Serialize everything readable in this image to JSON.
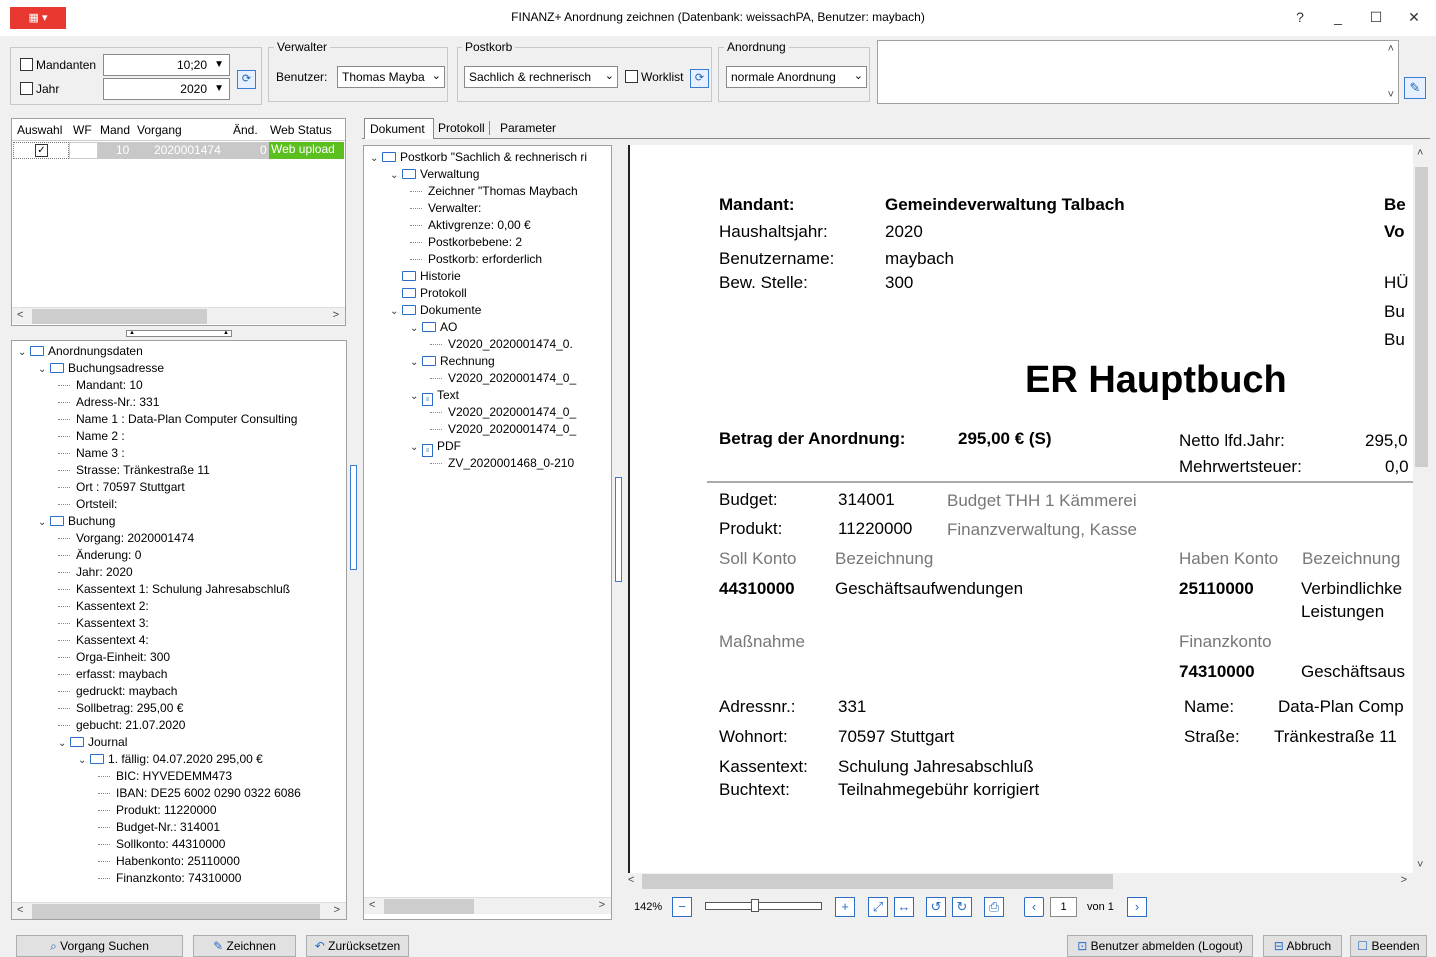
{
  "window": {
    "app_menu": "▦ ▾",
    "title": "FINANZ+ Anordnung zeichnen (Datenbank: weissachPA, Benutzer: maybach)",
    "help": "?",
    "minimize": "_",
    "maximize": "☐",
    "close": "✕"
  },
  "filters": {
    "mandanten_label": "Mandanten",
    "mandanten_value": "10;20",
    "jahr_label": "Jahr",
    "jahr_value": "2020",
    "verwalter_group": "Verwalter",
    "benutzer_label": "Benutzer:",
    "benutzer_value": "Thomas Mayba",
    "postkorb_group": "Postkorb",
    "postkorb_value": "Sachlich & rechnerisch",
    "worklist_label": "Worklist",
    "anordnung_group": "Anordnung",
    "anordnung_value": "normale Anordnung"
  },
  "grid": {
    "columns": [
      "Auswahl",
      "WF",
      "Mand",
      "Vorgang",
      "Änd.",
      "Web Status"
    ],
    "row": {
      "mand": "10",
      "vorgang": "2020001474",
      "aend": "0",
      "status": "Web upload"
    }
  },
  "left_tree": [
    {
      "label": "Anordnungsdaten",
      "level": 0,
      "type": "folder",
      "toggle": "v"
    },
    {
      "label": "Buchungsadresse",
      "level": 1,
      "type": "folder",
      "toggle": "v"
    },
    {
      "label": "Mandant: 10",
      "level": 2,
      "type": "leaf"
    },
    {
      "label": "Adress-Nr.: 331",
      "level": 2,
      "type": "leaf"
    },
    {
      "label": "Name 1 : Data-Plan Computer Consulting",
      "level": 2,
      "type": "leaf"
    },
    {
      "label": "Name 2 :",
      "level": 2,
      "type": "leaf"
    },
    {
      "label": "Name 3 :",
      "level": 2,
      "type": "leaf"
    },
    {
      "label": "Strasse: Tränkestraße 11",
      "level": 2,
      "type": "leaf"
    },
    {
      "label": "Ort    : 70597 Stuttgart",
      "level": 2,
      "type": "leaf"
    },
    {
      "label": "Ortsteil:",
      "level": 2,
      "type": "leaf"
    },
    {
      "label": "Buchung",
      "level": 1,
      "type": "folder",
      "toggle": "v"
    },
    {
      "label": "Vorgang: 2020001474",
      "level": 2,
      "type": "leaf"
    },
    {
      "label": "Änderung: 0",
      "level": 2,
      "type": "leaf"
    },
    {
      "label": "Jahr: 2020",
      "level": 2,
      "type": "leaf"
    },
    {
      "label": "Kassentext 1: Schulung Jahresabschluß",
      "level": 2,
      "type": "leaf"
    },
    {
      "label": "Kassentext 2:",
      "level": 2,
      "type": "leaf"
    },
    {
      "label": "Kassentext 3:",
      "level": 2,
      "type": "leaf"
    },
    {
      "label": "Kassentext 4:",
      "level": 2,
      "type": "leaf"
    },
    {
      "label": "Orga-Einheit: 300",
      "level": 2,
      "type": "leaf"
    },
    {
      "label": "erfasst: maybach",
      "level": 2,
      "type": "leaf"
    },
    {
      "label": "gedruckt: maybach",
      "level": 2,
      "type": "leaf"
    },
    {
      "label": "Sollbetrag: 295,00 €",
      "level": 2,
      "type": "leaf"
    },
    {
      "label": "gebucht: 21.07.2020",
      "level": 2,
      "type": "leaf"
    },
    {
      "label": "Journal",
      "level": 2,
      "type": "folder",
      "toggle": "v"
    },
    {
      "label": "1.   fällig: 04.07.2020  295,00 €",
      "level": 3,
      "type": "folder",
      "toggle": "v"
    },
    {
      "label": "BIC: HYVEDEMM473",
      "level": 4,
      "type": "leaf"
    },
    {
      "label": "IBAN: DE25 6002 0290 0322 6086",
      "level": 4,
      "type": "leaf"
    },
    {
      "label": "Produkt: 11220000",
      "level": 4,
      "type": "leaf"
    },
    {
      "label": "Budget-Nr.: 314001",
      "level": 4,
      "type": "leaf"
    },
    {
      "label": "Sollkonto: 44310000",
      "level": 4,
      "type": "leaf"
    },
    {
      "label": "Habenkonto: 25110000",
      "level": 4,
      "type": "leaf"
    },
    {
      "label": "Finanzkonto: 74310000",
      "level": 4,
      "type": "leaf"
    }
  ],
  "tabs": [
    "Dokument",
    "Protokoll",
    "Parameter"
  ],
  "doc_tree": [
    {
      "label": "Postkorb \"Sachlich & rechnerisch ri",
      "level": 0,
      "type": "folder",
      "toggle": "v"
    },
    {
      "label": "Verwaltung",
      "level": 1,
      "type": "folder",
      "toggle": "v"
    },
    {
      "label": "Zeichner \"Thomas Maybach",
      "level": 2,
      "type": "leaf"
    },
    {
      "label": "Verwalter:",
      "level": 2,
      "type": "leaf"
    },
    {
      "label": "Aktivgrenze: 0,00 €",
      "level": 2,
      "type": "leaf"
    },
    {
      "label": "Postkorbebene: 2",
      "level": 2,
      "type": "leaf"
    },
    {
      "label": "Postkorb: erforderlich",
      "level": 2,
      "type": "leaf"
    },
    {
      "label": "Historie",
      "level": 1,
      "type": "folder"
    },
    {
      "label": "Protokoll",
      "level": 1,
      "type": "folder"
    },
    {
      "label": "Dokumente",
      "level": 1,
      "type": "folder",
      "toggle": "v"
    },
    {
      "label": "AO",
      "level": 2,
      "type": "folder",
      "toggle": "v"
    },
    {
      "label": "V2020_2020001474_0.",
      "level": 3,
      "type": "leaf"
    },
    {
      "label": "Rechnung",
      "level": 2,
      "type": "folder",
      "toggle": "v"
    },
    {
      "label": "V2020_2020001474_0_",
      "level": 3,
      "type": "leaf"
    },
    {
      "label": "Text",
      "level": 2,
      "type": "doc",
      "toggle": "v"
    },
    {
      "label": "V2020_2020001474_0_",
      "level": 3,
      "type": "leaf"
    },
    {
      "label": "V2020_2020001474_0_",
      "level": 3,
      "type": "leaf"
    },
    {
      "label": "PDF",
      "level": 2,
      "type": "doc",
      "toggle": "v"
    },
    {
      "label": "ZV_2020001468_0-210",
      "level": 3,
      "type": "leaf"
    }
  ],
  "document": {
    "mandant_label": "Mandant:",
    "mandant_value": "Gemeindeverwaltung Talbach",
    "haushalt_label": "Haushaltsjahr:",
    "haushalt_value": "2020",
    "benutzer_label": "Benutzername:",
    "benutzer_value": "maybach",
    "stelle_label": "Bew. Stelle:",
    "stelle_value": "300",
    "right_col": [
      "Be",
      "Vo",
      "HÜ",
      "Bu",
      "Bu"
    ],
    "heading": "ER Hauptbuch",
    "betrag_label": "Betrag der Anordnung:",
    "betrag_value": "295,00 € (S)",
    "netto_label": "Netto lfd.Jahr:",
    "netto_value": "295,0",
    "mwst_label": "Mehrwertsteuer:",
    "mwst_value": "0,0",
    "budget_label": "Budget:",
    "budget_value": "314001",
    "budget_desc": "Budget THH 1 Kämmerei",
    "produkt_label": "Produkt:",
    "produkt_value": "11220000",
    "produkt_desc": "Finanzverwaltung, Kasse",
    "soll_konto_h": "Soll Konto",
    "bezeichnung_h": "Bezeichnung",
    "haben_konto_h": "Haben Konto",
    "bezeichnung_h2": "Bezeichnung",
    "soll_konto": "44310000",
    "soll_desc": "Geschäftsaufwendungen",
    "haben_konto": "25110000",
    "haben_desc1": "Verbindlichke",
    "haben_desc2": "Leistungen",
    "massnahme_h": "Maßnahme",
    "finanzkonto_h": "Finanzkonto",
    "finanzkonto": "74310000",
    "finanz_desc": "Geschäftsaus",
    "adressnr_label": "Adressnr.:",
    "adressnr_value": "331",
    "name_label": "Name:",
    "name_value": "Data-Plan Comp",
    "wohnort_label": "Wohnort:",
    "wohnort_value": "70597 Stuttgart",
    "strasse_label": "Straße:",
    "strasse_value": "Tränkestraße 11",
    "kassentext_label": "Kassentext:",
    "kassentext_value": "Schulung Jahresabschluß",
    "buchtext_label": "Buchtext:",
    "buchtext_value": "Teilnahmegebühr korrigiert"
  },
  "viewer": {
    "zoom": "142%",
    "page": "1",
    "of": "von 1"
  },
  "buttons": {
    "vorgang_suchen": "Vorgang Suchen",
    "zeichnen": "Zeichnen",
    "zuruecksetzen": "Zurücksetzen",
    "logout": "Benutzer abmelden (Logout)",
    "abbruch": "Abbruch",
    "beenden": "Beenden"
  }
}
